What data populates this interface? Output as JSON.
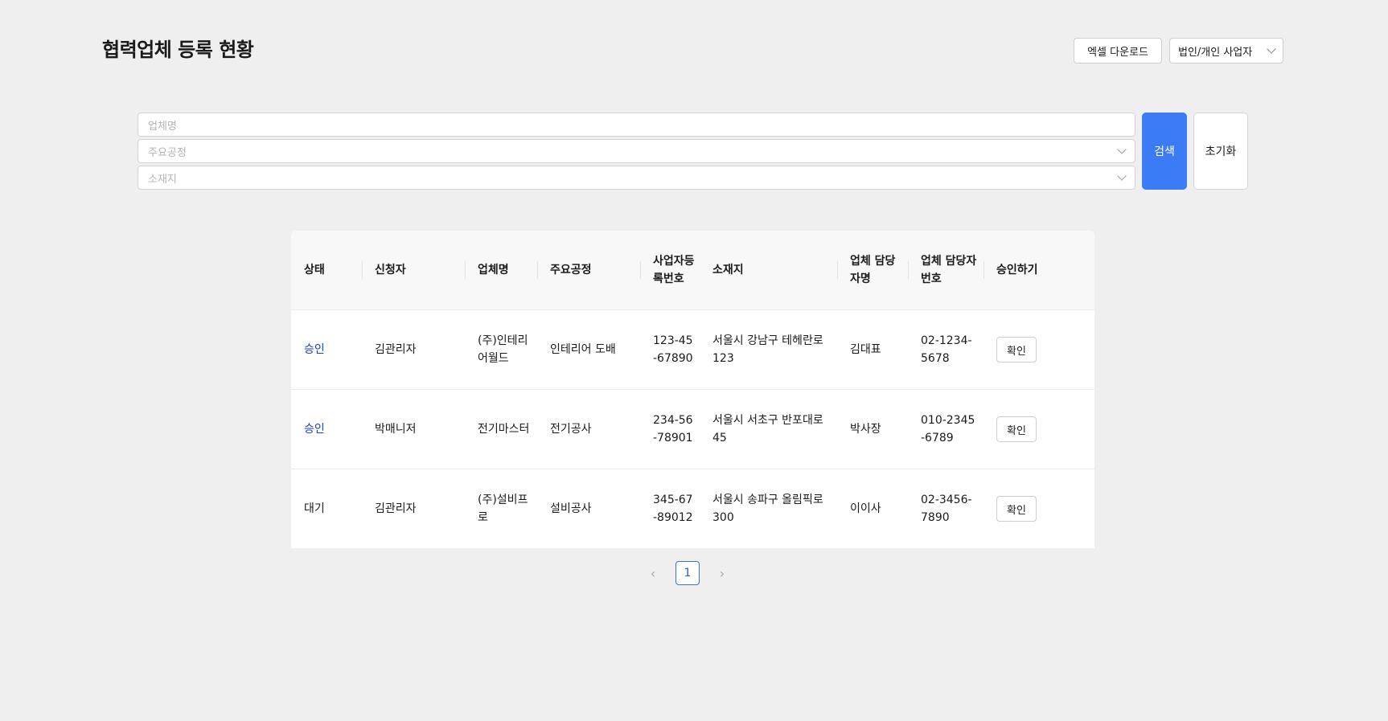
{
  "header": {
    "title": "협력업체 등록 현황",
    "excel_label": "엑셀 다운로드",
    "type_select_value": "법인/개인 사업자"
  },
  "filters": {
    "name_placeholder": "업체명",
    "process_placeholder": "주요공정",
    "location_placeholder": "소재지",
    "search_label": "검색",
    "reset_label": "초기화"
  },
  "table": {
    "headers": [
      "상태",
      "신청자",
      "업체명",
      "주요공정",
      "사업자등록번호",
      "소재지",
      "업체 담당자명",
      "업체 담당자 번호",
      "승인하기"
    ],
    "rows": [
      {
        "status": "승인",
        "applicant": "김관리자",
        "company": "(주)인테리어월드",
        "process": "인테리어 도배",
        "biz_no": "123-45-67890",
        "location": "서울시 강남구 테헤란로 123",
        "manager": "김대표",
        "phone": "02-1234-5678",
        "action": "확인"
      },
      {
        "status": "승인",
        "applicant": "박매니저",
        "company": "전기마스터",
        "process": "전기공사",
        "biz_no": "234-56-78901",
        "location": "서울시 서초구 반포대로 45",
        "manager": "박사장",
        "phone": "010-2345-6789",
        "action": "확인"
      },
      {
        "status": "대기",
        "applicant": "김관리자",
        "company": "(주)설비프로",
        "process": "설비공사",
        "biz_no": "345-67-89012",
        "location": "서울시 송파구 올림픽로 300",
        "manager": "이이사",
        "phone": "02-3456-7890",
        "action": "확인"
      }
    ]
  },
  "pagination": {
    "current": "1",
    "prev": "‹",
    "next": "›"
  },
  "colors": {
    "primary": "#3b7cf6",
    "approved_text": "#1a3fbf",
    "background": "#efefef"
  }
}
